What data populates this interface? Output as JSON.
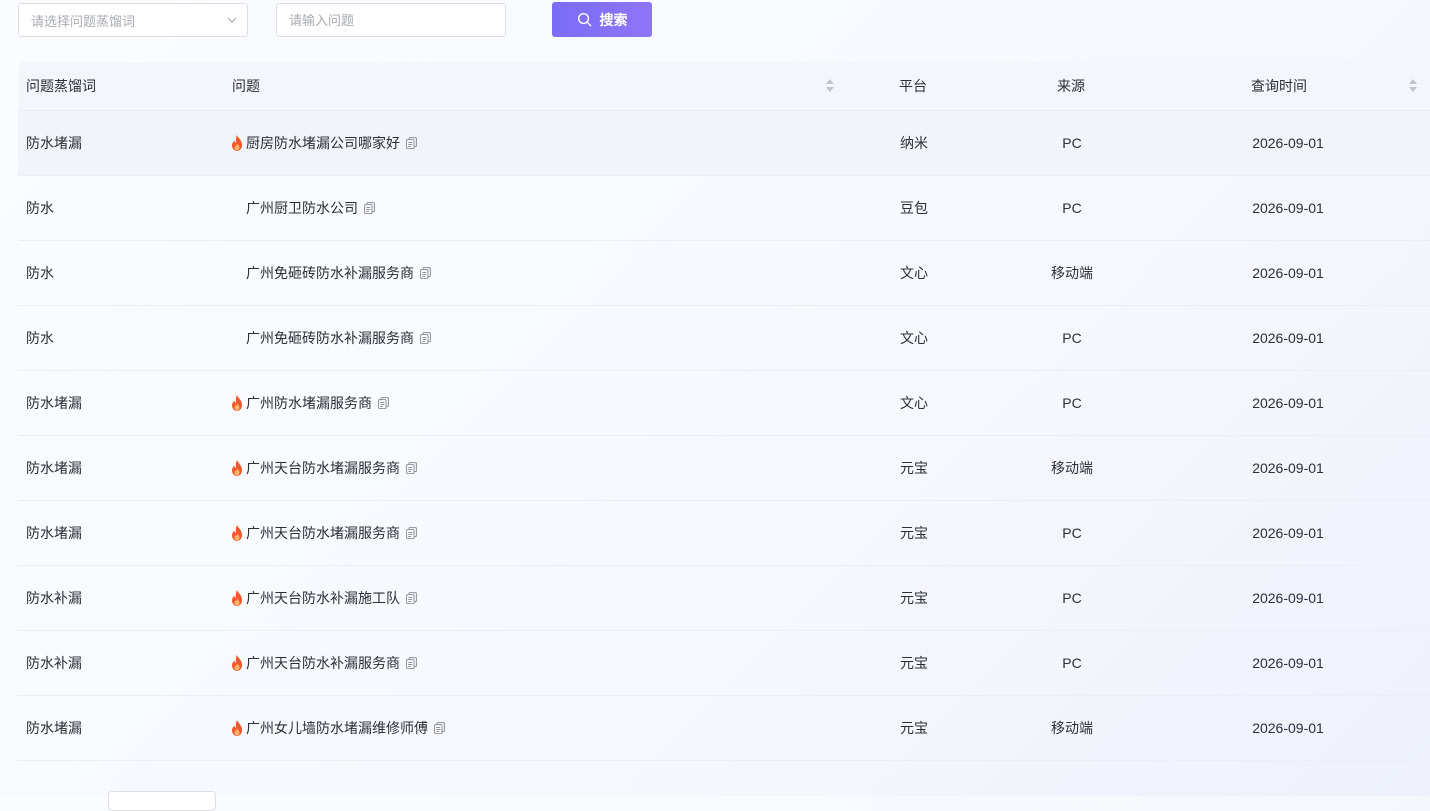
{
  "filters": {
    "keyword_select_placeholder": "请选择问题蒸馏词",
    "question_input_placeholder": "请输入问题",
    "search_button_label": "搜索"
  },
  "table": {
    "headers": {
      "keyword": "问题蒸馏词",
      "question": "问题",
      "platform": "平台",
      "source": "来源",
      "query_time": "查询时间"
    },
    "rows": [
      {
        "keyword": "防水堵漏",
        "hot": true,
        "question": "厨房防水堵漏公司哪家好",
        "platform": "纳米",
        "source": "PC",
        "time": "2026-09-01"
      },
      {
        "keyword": "防水",
        "hot": false,
        "question": "广州厨卫防水公司",
        "platform": "豆包",
        "source": "PC",
        "time": "2026-09-01"
      },
      {
        "keyword": "防水",
        "hot": false,
        "question": "广州免砸砖防水补漏服务商",
        "platform": "文心",
        "source": "移动端",
        "time": "2026-09-01"
      },
      {
        "keyword": "防水",
        "hot": false,
        "question": "广州免砸砖防水补漏服务商",
        "platform": "文心",
        "source": "PC",
        "time": "2026-09-01"
      },
      {
        "keyword": "防水堵漏",
        "hot": true,
        "question": "广州防水堵漏服务商",
        "platform": "文心",
        "source": "PC",
        "time": "2026-09-01"
      },
      {
        "keyword": "防水堵漏",
        "hot": true,
        "question": "广州天台防水堵漏服务商",
        "platform": "元宝",
        "source": "移动端",
        "time": "2026-09-01"
      },
      {
        "keyword": "防水堵漏",
        "hot": true,
        "question": "广州天台防水堵漏服务商",
        "platform": "元宝",
        "source": "PC",
        "time": "2026-09-01"
      },
      {
        "keyword": "防水补漏",
        "hot": true,
        "question": "广州天台防水补漏施工队",
        "platform": "元宝",
        "source": "PC",
        "time": "2026-09-01"
      },
      {
        "keyword": "防水补漏",
        "hot": true,
        "question": "广州天台防水补漏服务商",
        "platform": "元宝",
        "source": "PC",
        "time": "2026-09-01"
      },
      {
        "keyword": "防水堵漏",
        "hot": true,
        "question": "广州女儿墙防水堵漏维修师傅",
        "platform": "元宝",
        "source": "移动端",
        "time": "2026-09-01"
      }
    ]
  },
  "icons": {
    "search": "search-icon",
    "chevron": "chevron-down-icon",
    "hot": "flame-icon",
    "copy": "copy-icon",
    "sort": "sort-icon"
  },
  "colors": {
    "accent_start": "#7b6cf6",
    "accent_end": "#8f74f7",
    "flame": "#f0572d",
    "header_bg": "#f4f6fc"
  }
}
